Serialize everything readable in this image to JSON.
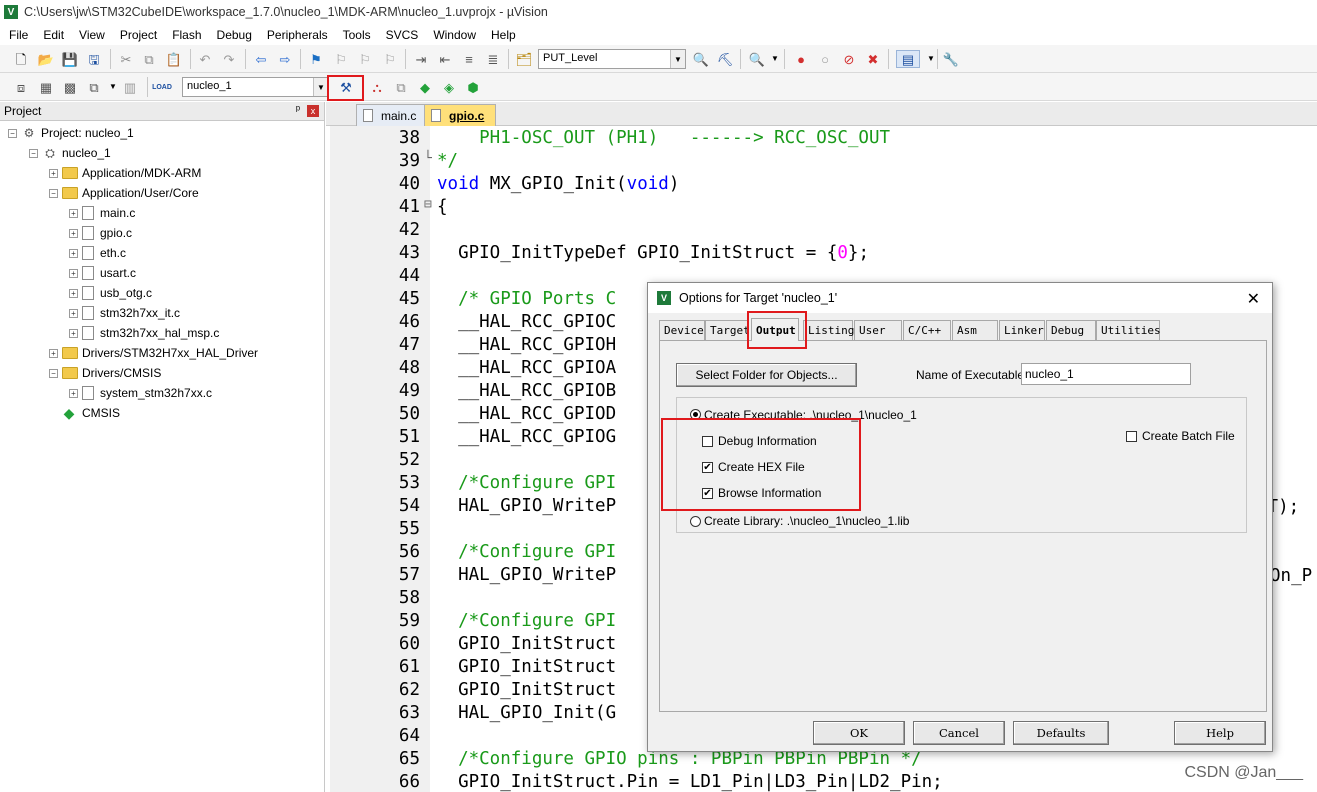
{
  "window": {
    "title": "C:\\Users\\jw\\STM32CubeIDE\\workspace_1.7.0\\nucleo_1\\MDK-ARM\\nucleo_1.uvprojx - µVision",
    "app_icon": "uvision-logo-icon"
  },
  "menu": [
    "File",
    "Edit",
    "View",
    "Project",
    "Flash",
    "Debug",
    "Peripherals",
    "Tools",
    "SVCS",
    "Window",
    "Help"
  ],
  "toolbar1": {
    "find_combo": "PUT_Level"
  },
  "toolbar2": {
    "target_combo": "nucleo_1",
    "load_label": "LOAD"
  },
  "project_panel": {
    "title": "Project",
    "pin": "ᵖ",
    "close": "x",
    "tree": [
      {
        "label": "Project: nucleo_1",
        "expander": "−",
        "icon": "project"
      },
      {
        "label": "nucleo_1",
        "expander": "−",
        "icon": "target"
      },
      {
        "label": "Application/MDK-ARM",
        "expander": "+",
        "icon": "folder"
      },
      {
        "label": "Application/User/Core",
        "expander": "−",
        "icon": "folder"
      },
      {
        "label": "main.c",
        "expander": "+",
        "icon": "file"
      },
      {
        "label": "gpio.c",
        "expander": "+",
        "icon": "file"
      },
      {
        "label": "eth.c",
        "expander": "+",
        "icon": "file"
      },
      {
        "label": "usart.c",
        "expander": "+",
        "icon": "file"
      },
      {
        "label": "usb_otg.c",
        "expander": "+",
        "icon": "file"
      },
      {
        "label": "stm32h7xx_it.c",
        "expander": "+",
        "icon": "file"
      },
      {
        "label": "stm32h7xx_hal_msp.c",
        "expander": "+",
        "icon": "file"
      },
      {
        "label": "Drivers/STM32H7xx_HAL_Driver",
        "expander": "+",
        "icon": "folder"
      },
      {
        "label": "Drivers/CMSIS",
        "expander": "−",
        "icon": "folder"
      },
      {
        "label": "system_stm32h7xx.c",
        "expander": "+",
        "icon": "file"
      },
      {
        "label": "CMSIS",
        "expander": "",
        "icon": "cmsis"
      }
    ]
  },
  "editor": {
    "tabs": [
      {
        "label": "main.c",
        "active": false
      },
      {
        "label": "gpio.c",
        "active": true
      }
    ],
    "lines": [
      {
        "n": "38",
        "fold": "",
        "text": "    PH1-OSC_OUT (PH1)   ------> RCC_OSC_OUT",
        "cls": "c-green"
      },
      {
        "n": "39",
        "fold": "└",
        "text": "*/",
        "cls": "c-green"
      },
      {
        "n": "40",
        "fold": "",
        "text": "void MX_GPIO_Init(void)",
        "cls": "c-plain"
      },
      {
        "n": "41",
        "fold": "⊟",
        "text": "{",
        "cls": "c-plain"
      },
      {
        "n": "42",
        "fold": "",
        "text": "",
        "cls": "c-plain"
      },
      {
        "n": "43",
        "fold": "",
        "text": "  GPIO_InitTypeDef GPIO_InitStruct = {0};",
        "cls": "c-plain"
      },
      {
        "n": "44",
        "fold": "",
        "text": "",
        "cls": "c-plain"
      },
      {
        "n": "45",
        "fold": "",
        "text": "  /* GPIO Ports C",
        "cls": "c-green"
      },
      {
        "n": "46",
        "fold": "",
        "text": "  __HAL_RCC_GPIOC",
        "cls": "c-plain"
      },
      {
        "n": "47",
        "fold": "",
        "text": "  __HAL_RCC_GPIOH",
        "cls": "c-plain"
      },
      {
        "n": "48",
        "fold": "",
        "text": "  __HAL_RCC_GPIOA",
        "cls": "c-plain"
      },
      {
        "n": "49",
        "fold": "",
        "text": "  __HAL_RCC_GPIOB",
        "cls": "c-plain"
      },
      {
        "n": "50",
        "fold": "",
        "text": "  __HAL_RCC_GPIOD",
        "cls": "c-plain"
      },
      {
        "n": "51",
        "fold": "",
        "text": "  __HAL_RCC_GPIOG",
        "cls": "c-plain"
      },
      {
        "n": "52",
        "fold": "",
        "text": "",
        "cls": "c-plain"
      },
      {
        "n": "53",
        "fold": "",
        "text": "  /*Configure GPI",
        "cls": "c-green"
      },
      {
        "n": "54",
        "fold": "",
        "text": "  HAL_GPIO_WriteP",
        "cls": "c-plain"
      },
      {
        "n": "55",
        "fold": "",
        "text": "",
        "cls": "c-plain"
      },
      {
        "n": "56",
        "fold": "",
        "text": "  /*Configure GPI",
        "cls": "c-green"
      },
      {
        "n": "57",
        "fold": "",
        "text": "  HAL_GPIO_WriteP",
        "cls": "c-plain"
      },
      {
        "n": "58",
        "fold": "",
        "text": "",
        "cls": "c-plain"
      },
      {
        "n": "59",
        "fold": "",
        "text": "  /*Configure GPI",
        "cls": "c-green"
      },
      {
        "n": "60",
        "fold": "",
        "text": "  GPIO_InitStruct",
        "cls": "c-plain"
      },
      {
        "n": "61",
        "fold": "",
        "text": "  GPIO_InitStruct",
        "cls": "c-plain"
      },
      {
        "n": "62",
        "fold": "",
        "text": "  GPIO_InitStruct",
        "cls": "c-plain"
      },
      {
        "n": "63",
        "fold": "",
        "text": "  HAL_GPIO_Init(G",
        "cls": "c-plain"
      },
      {
        "n": "64",
        "fold": "",
        "text": "",
        "cls": "c-plain"
      },
      {
        "n": "65",
        "fold": "",
        "text": "  /*Configure GPIO pins : PBPin PBPin PBPin */",
        "cls": "c-green"
      },
      {
        "n": "66",
        "fold": "",
        "text": "  GPIO_InitStruct.Pin = LD1_Pin|LD3_Pin|LD2_Pin;",
        "cls": "c-plain"
      }
    ],
    "right_fragments": {
      "line54": "ET);",
      "line57": "On_P"
    }
  },
  "dialog": {
    "title": "Options for Target 'nucleo_1'",
    "close": "✕",
    "tabs": [
      "Device",
      "Target",
      "Output",
      "Listing",
      "User",
      "C/C++",
      "Asm",
      "Linker",
      "Debug",
      "Utilities"
    ],
    "active_tab": "Output",
    "select_folder_button": "Select Folder for Objects...",
    "name_of_executable_label": "Name of Executable:",
    "name_of_executable_value": "nucleo_1",
    "create_executable_label": "Create Executable:  .\\nucleo_1\\nucleo_1",
    "debug_info_label": "Debug Information",
    "debug_info_checked": false,
    "create_hex_label": "Create HEX File",
    "create_hex_checked": true,
    "browse_info_label": "Browse Information",
    "browse_info_checked": true,
    "create_batch_label": "Create Batch File",
    "create_batch_checked": false,
    "create_library_label": "Create Library:  .\\nucleo_1\\nucleo_1.lib",
    "buttons": {
      "ok": "OK",
      "cancel": "Cancel",
      "defaults": "Defaults",
      "help": "Help"
    }
  },
  "watermark": "CSDN @Jan___",
  "colors": {
    "highlight": "#e0191c",
    "comment": "#1a9a1a",
    "keyword": "#0000ff",
    "number": "#ff00ff",
    "active_tab": "#ffe07a"
  }
}
